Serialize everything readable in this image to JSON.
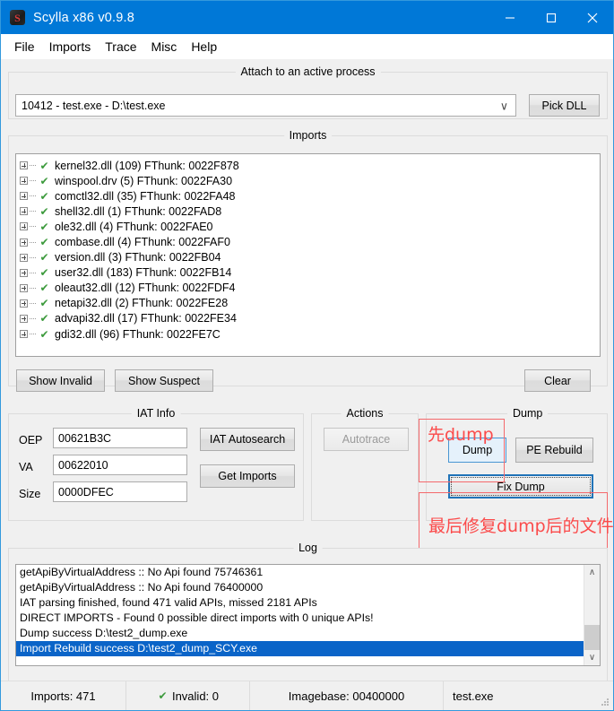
{
  "window": {
    "title": "Scylla x86 v0.9.8",
    "icon_letter": "S",
    "minimize": "minimize-icon",
    "maximize": "maximize-icon",
    "close": "close-icon"
  },
  "menubar": {
    "items": [
      {
        "label": "File"
      },
      {
        "label": "Imports"
      },
      {
        "label": "Trace"
      },
      {
        "label": "Misc"
      },
      {
        "label": "Help"
      }
    ]
  },
  "attach": {
    "group_title": "Attach to an active process",
    "process_value": "10412 - test.exe - D:\\test.exe",
    "dropdown_arrow": "∨",
    "pick_dll_label": "Pick DLL"
  },
  "imports": {
    "group_title": "Imports",
    "rows": [
      {
        "label": "kernel32.dll (109) FThunk: 0022F878"
      },
      {
        "label": "winspool.drv (5) FThunk: 0022FA30"
      },
      {
        "label": "comctl32.dll (35) FThunk: 0022FA48"
      },
      {
        "label": "shell32.dll (1) FThunk: 0022FAD8"
      },
      {
        "label": "ole32.dll (4) FThunk: 0022FAE0"
      },
      {
        "label": "combase.dll (4) FThunk: 0022FAF0"
      },
      {
        "label": "version.dll (3) FThunk: 0022FB04"
      },
      {
        "label": "user32.dll (183) FThunk: 0022FB14"
      },
      {
        "label": "oleaut32.dll (12) FThunk: 0022FDF4"
      },
      {
        "label": "netapi32.dll (2) FThunk: 0022FE28"
      },
      {
        "label": "advapi32.dll (17) FThunk: 0022FE34"
      },
      {
        "label": "gdi32.dll (96) FThunk: 0022FE7C"
      }
    ],
    "check_glyph": "✔",
    "show_invalid_label": "Show Invalid",
    "show_suspect_label": "Show Suspect",
    "clear_label": "Clear"
  },
  "iat_info": {
    "group_title": "IAT Info",
    "oep_label": "OEP",
    "oep_value": "00621B3C",
    "va_label": "VA",
    "va_value": "00622010",
    "size_label": "Size",
    "size_value": "0000DFEC",
    "iat_autosearch_label": "IAT Autosearch",
    "get_imports_label": "Get Imports"
  },
  "actions": {
    "group_title": "Actions",
    "autotrace_label": "Autotrace"
  },
  "dump": {
    "group_title": "Dump",
    "dump_label": "Dump",
    "pe_rebuild_label": "PE Rebuild",
    "fix_dump_label": "Fix Dump"
  },
  "annotations": {
    "color": "#fb4a4a",
    "first": "先dump",
    "second": "最后修复dump后的文件"
  },
  "log": {
    "group_title": "Log",
    "lines": [
      {
        "text": "getApiByVirtualAddress :: No Api found 75746361",
        "selected": false
      },
      {
        "text": "getApiByVirtualAddress :: No Api found 76400000",
        "selected": false
      },
      {
        "text": "IAT parsing finished, found 471 valid APIs, missed 2181 APIs",
        "selected": false
      },
      {
        "text": "DIRECT IMPORTS - Found 0 possible direct imports with 0 unique APIs!",
        "selected": false
      },
      {
        "text": "Dump success D:\\test2_dump.exe",
        "selected": false
      },
      {
        "text": "Import Rebuild success D:\\test2_dump_SCY.exe",
        "selected": true
      }
    ],
    "scroll_up": "∧",
    "scroll_down": "∨"
  },
  "statusbar": {
    "imports": "Imports: 471",
    "invalid": "Invalid: 0",
    "invalid_check": "✔",
    "imagebase": "Imagebase: 00400000",
    "filename": "test.exe"
  }
}
